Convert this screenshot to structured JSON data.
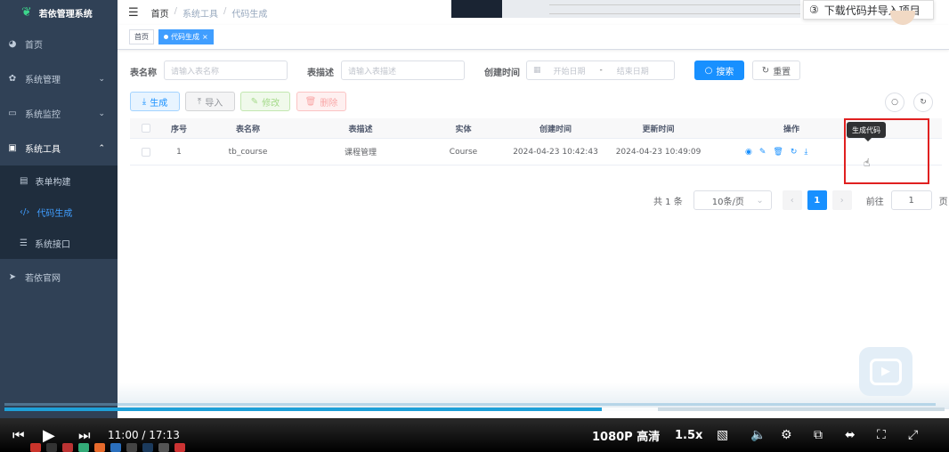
{
  "app": {
    "title": "若依管理系统"
  },
  "sidebar": {
    "items": [
      {
        "label": "首页",
        "icon": "dashboard-icon"
      },
      {
        "label": "系统管理",
        "icon": "gear-icon"
      },
      {
        "label": "系统监控",
        "icon": "monitor-icon"
      },
      {
        "label": "系统工具",
        "icon": "toolbox-icon"
      }
    ],
    "tools_sub": [
      {
        "label": "表单构建",
        "icon": "form-icon"
      },
      {
        "label": "代码生成",
        "icon": "code-icon"
      },
      {
        "label": "系统接口",
        "icon": "swagger-icon"
      }
    ],
    "external": {
      "label": "若依官网",
      "icon": "send-icon"
    }
  },
  "header": {
    "breadcrumb": [
      "首页",
      "系统工具",
      "代码生成"
    ],
    "step_tooltip": "下载代码并导入项目",
    "step_number": "③"
  },
  "tags": {
    "home": "首页",
    "active": "代码生成"
  },
  "search": {
    "table_name_label": "表名称",
    "table_name_placeholder": "请输入表名称",
    "table_comment_label": "表描述",
    "table_comment_placeholder": "请输入表描述",
    "create_time_label": "创建时间",
    "start_placeholder": "开始日期",
    "range_sep": "-",
    "end_placeholder": "结束日期",
    "search_button": "搜索",
    "reset_button": "重置"
  },
  "toolbar": {
    "generate": "生成",
    "import": "导入",
    "edit": "修改",
    "delete": "删除"
  },
  "table": {
    "columns": [
      "序号",
      "表名称",
      "表描述",
      "实体",
      "创建时间",
      "更新时间",
      "操作"
    ],
    "rows": [
      {
        "index": "1",
        "table_name": "tb_course",
        "table_comment": "课程管理",
        "entity": "Course",
        "create_time": "2024-04-23 10:42:43",
        "update_time": "2024-04-23 10:49:09"
      }
    ],
    "action_tooltip": "生成代码"
  },
  "pagination": {
    "total": "共 1 条",
    "page_size": "10条/页",
    "current_page": "1",
    "goto_label": "前往",
    "goto_value": "1",
    "page_unit": "页"
  },
  "player": {
    "time": "11:00 / 17:13",
    "quality": "1080P 高清",
    "speed": "1.5x",
    "progress": 0.635,
    "buffered": 0.695
  },
  "colors": {
    "sidebar": "#304156",
    "primary": "#1890ff",
    "highlight": "#e02020"
  }
}
